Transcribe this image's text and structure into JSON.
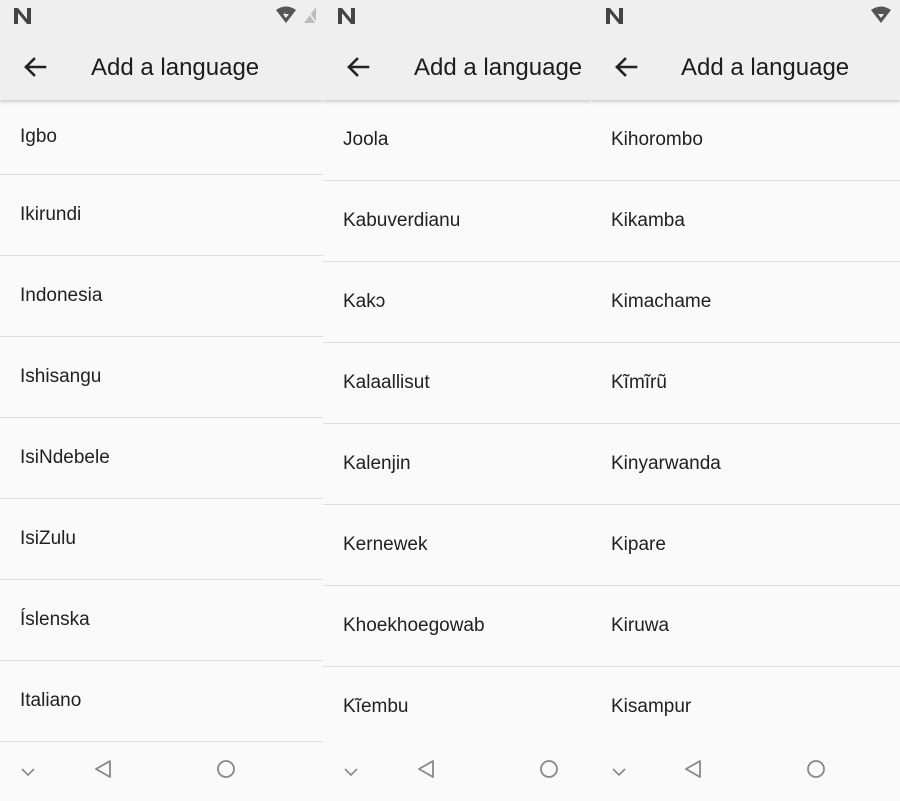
{
  "screens": [
    {
      "title": "Add a language",
      "languages": [
        "Igbo",
        "Ikirundi",
        "Indonesia",
        "Ishisangu",
        "IsiNdebele",
        "IsiZulu",
        "Íslenska",
        "Italiano"
      ]
    },
    {
      "title": "Add a language",
      "languages": [
        "Joola",
        "Kabuverdianu",
        "Kakɔ",
        "Kalaallisut",
        "Kalenjin",
        "Kernewek",
        "Khoekhoegowab",
        "Kĩembu"
      ]
    },
    {
      "title": "Add a language",
      "languages": [
        "Kihorombo",
        "Kikamba",
        "Kimachame",
        "Kĩmĩrũ",
        "Kinyarwanda",
        "Kipare",
        "Kiruwa",
        "Kisampur"
      ]
    }
  ],
  "icons": {
    "status_logo": "n-notification-icon",
    "wifi": "wifi-icon",
    "signal": "cell-signal-icon",
    "back": "back-arrow-icon",
    "nav_collapse": "chevron-down-icon",
    "nav_back": "triangle-back-icon",
    "nav_home": "circle-home-icon"
  },
  "colors": {
    "appbar_bg": "#efefef",
    "list_bg": "#fafafa",
    "divider": "#dedede",
    "text_primary": "#212121",
    "icon_gray": "#777777"
  }
}
